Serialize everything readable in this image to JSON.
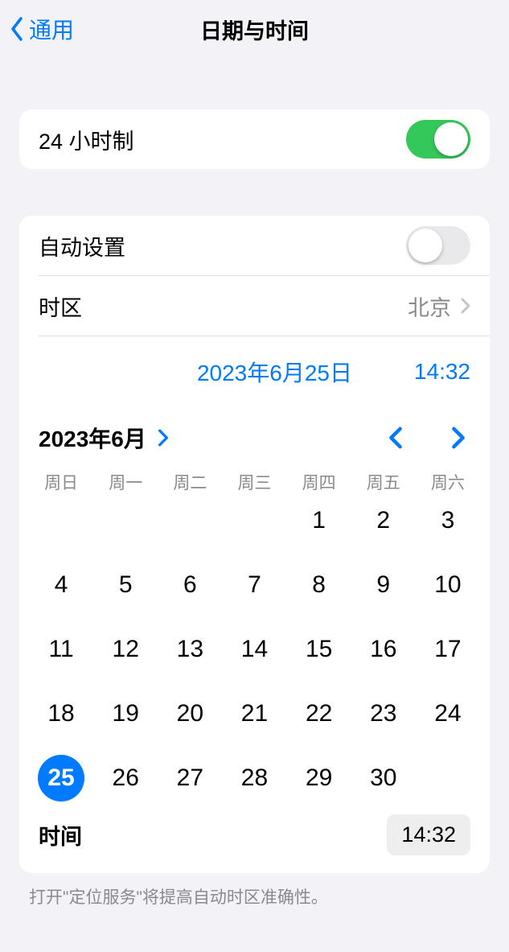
{
  "header": {
    "back_label": "通用",
    "title": "日期与时间"
  },
  "twentyFourHour": {
    "label": "24 小时制",
    "enabled": true
  },
  "autoSet": {
    "label": "自动设置",
    "enabled": false
  },
  "timezone": {
    "label": "时区",
    "value": "北京"
  },
  "current": {
    "date": "2023年6月25日",
    "time": "14:32"
  },
  "calendar": {
    "month_label": "2023年6月",
    "weekdays": [
      "周日",
      "周一",
      "周二",
      "周三",
      "周四",
      "周五",
      "周六"
    ],
    "leading_blanks": 4,
    "days_in_month": 30,
    "selected_day": 25
  },
  "timePicker": {
    "label": "时间",
    "value": "14:32"
  },
  "footer": {
    "note": "打开\"定位服务\"将提高自动时区准确性。"
  }
}
